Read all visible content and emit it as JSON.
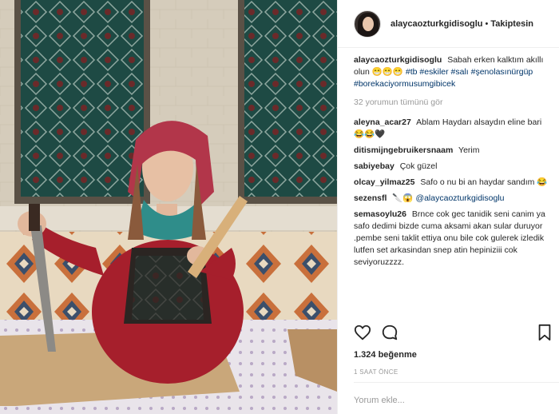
{
  "header": {
    "username": "alaycaozturkgidisoglu",
    "separator": "•",
    "follow_label": "Takiptesin"
  },
  "caption": {
    "username": "alaycaozturkgidisoglu",
    "text": "Sabah erken kalktım akıllı olun 😁😁😁",
    "hashtags": "#tb #eskiler #salı #şenolasınürgüp #borekaciyormusumgibicek"
  },
  "view_all": "32 yorumun tümünü gör",
  "comments": [
    {
      "username": "aleyna_acar27",
      "text": "Ablam Haydarı alsaydın eline bari 😂😂🖤"
    },
    {
      "username": "ditismijngebruikersnaam",
      "text": "Yerim"
    },
    {
      "username": "sabiyebay",
      "text": "Çok güzel"
    },
    {
      "username": "olcay_yilmaz25",
      "text": "Safo o nu bi an haydar sandım 😂"
    },
    {
      "username": "sezensfl",
      "text": "🔪😱",
      "mention": "@alaycaozturkgidisoglu"
    },
    {
      "username": "semasoylu26",
      "text": "Brnce cok gec tanidik seni canim ya safo dedimi bizde cuma aksami akan sular duruyor .pembe seni taklit ettiya onu bile cok gulerek izledik lutfen set arkasindan snep atin hepiniziii cok seviyoruzzzz."
    }
  ],
  "likes": "1.324 beğenme",
  "time": "1 SAAT ÖNCE",
  "comment_input": {
    "placeholder": "Yorum ekle..."
  },
  "icons": {
    "like": "heart-icon",
    "comment": "comment-bubble-icon",
    "save": "bookmark-icon"
  }
}
